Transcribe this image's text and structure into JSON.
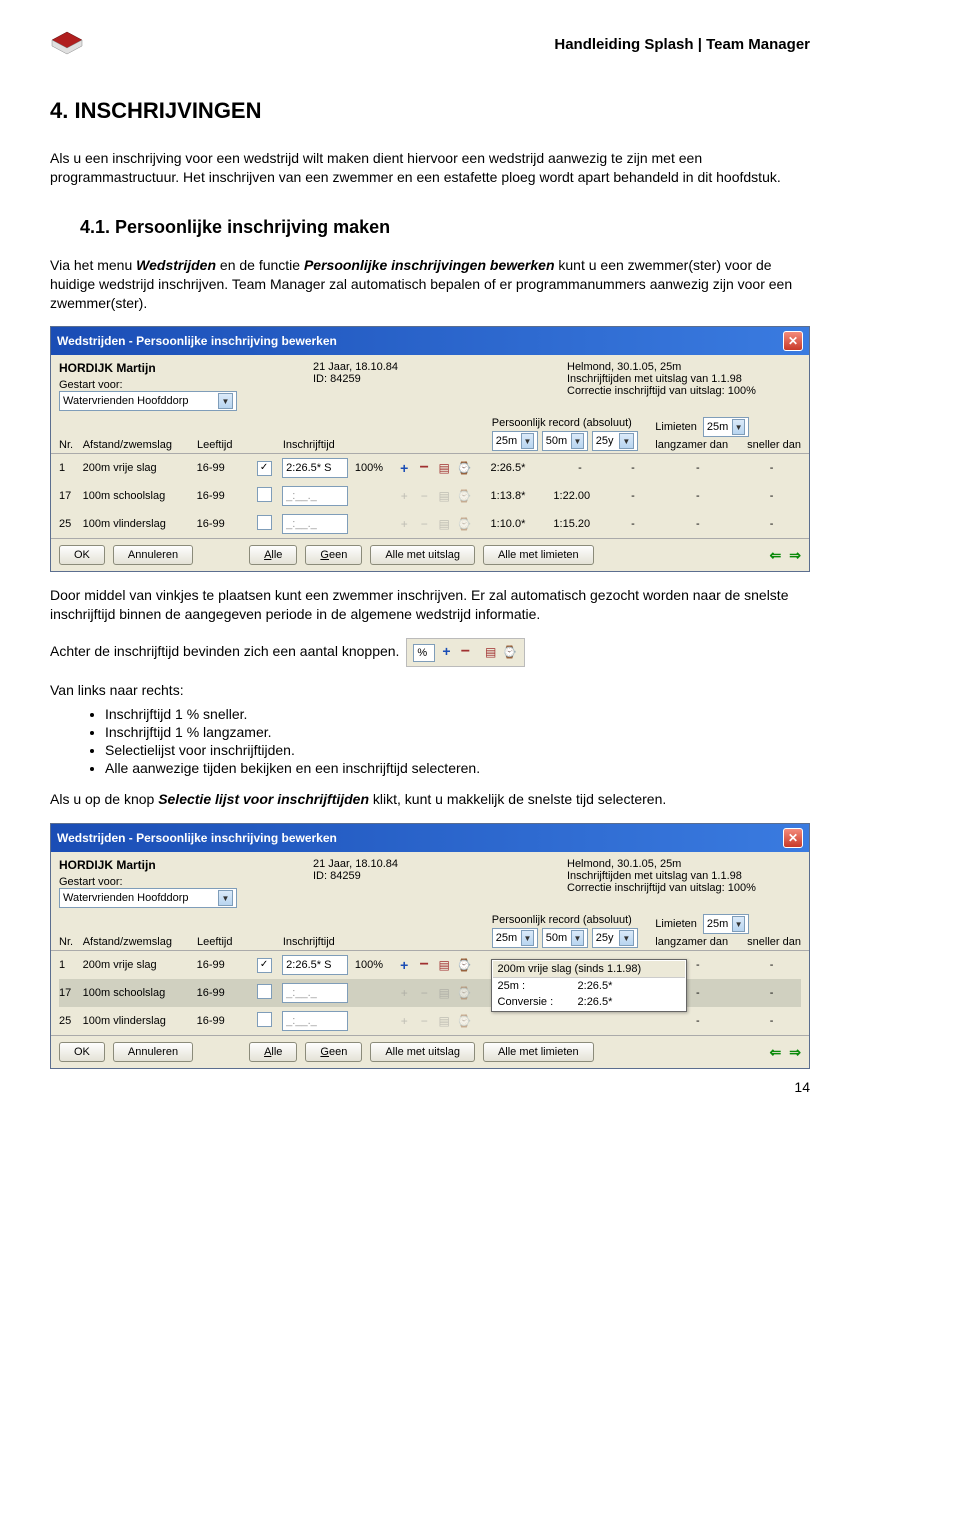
{
  "header": {
    "doc_title": "Handleiding Splash | Team Manager"
  },
  "h1": "4.  INSCHRIJVINGEN",
  "p1": "Als u een inschrijving voor een wedstrijd wilt maken dient hiervoor een wedstrijd aanwezig te zijn met een programmastructuur. Het inschrijven van een zwemmer en een estafette ploeg wordt apart behandeld in dit hoofdstuk.",
  "h2": "4.1.   Persoonlijke inschrijving maken",
  "p2a": "Via het menu ",
  "p2b": "Wedstrijden",
  "p2c": " en de functie ",
  "p2d": "Persoonlijke inschrijvingen bewerken",
  "p2e": " kunt u een zwemmer(ster) voor de huidige wedstrijd inschrijven. Team Manager zal automatisch bepalen of er programmanummers aanwezig zijn voor een zwemmer(ster).",
  "win": {
    "title": "Wedstrijden - Persoonlijke inschrijving bewerken",
    "swimmer": "HORDIJK Martijn",
    "started_label": "Gestart voor:",
    "club": "Watervrienden Hoofddorp",
    "age_line": "21 Jaar, 18.10.84",
    "id_line": "ID: 84259",
    "meet_line": "Helmond, 30.1.05, 25m",
    "entrytimes_line": "Inschrijftijden met uitslag van 1.1.98",
    "correction_line": "Correctie inschrijftijd van uitslag: 100%",
    "hdr_nr": "Nr.",
    "hdr_event": "Afstand/zwemslag",
    "hdr_age": "Leeftijd",
    "hdr_entrytime": "Inschrijftijd",
    "hdr_pr": "Persoonlijk record (absoluut)",
    "hdr_limits": "Limieten",
    "hdr_slower": "langzamer dan",
    "hdr_faster": "sneller dan",
    "pr_25": "25m",
    "pr_50": "50m",
    "pr_25y": "25y",
    "lim_25": "25m",
    "rows": [
      {
        "nr": "1",
        "event": "200m vrije slag",
        "age": "16-99",
        "checked": true,
        "time": "2:26.5* S",
        "pct": "100%",
        "pr25": "2:26.5*",
        "pr50": "-",
        "pr25y": "-",
        "l1": "-",
        "l2": "-"
      },
      {
        "nr": "17",
        "event": "100m schoolslag",
        "age": "16-99",
        "checked": false,
        "time": "_:__._",
        "pct": "",
        "pr25": "1:13.8*",
        "pr50": "1:22.00",
        "pr25y": "-",
        "l1": "-",
        "l2": "-"
      },
      {
        "nr": "25",
        "event": "100m vlinderslag",
        "age": "16-99",
        "checked": false,
        "time": "_:__._",
        "pct": "",
        "pr25": "1:10.0*",
        "pr50": "1:15.20",
        "pr25y": "-",
        "l1": "-",
        "l2": "-"
      }
    ],
    "btn_ok": "OK",
    "btn_cancel": "Annuleren",
    "btn_all": "Alle",
    "btn_none": "Geen",
    "btn_all_result": "Alle met uitslag",
    "btn_all_limit": "Alle met limieten"
  },
  "p3": "Door middel van vinkjes te plaatsen kunt een zwemmer inschrijven. Er zal automatisch gezocht worden naar de snelste inschrijftijd binnen de aangegeven periode in de algemene wedstrijd informatie.",
  "p4": "Achter de inschrijftijd bevinden zich een aantal knoppen.",
  "inline_percent": "%",
  "list_lead": "Van links naar rechts:",
  "li1": "Inschrijftijd 1 % sneller.",
  "li2": "Inschrijftijd 1 % langzamer.",
  "li3": "Selectielijst voor inschrijftijden.",
  "li4": "Alle aanwezige tijden bekijken en een inschrijftijd selecteren.",
  "p5a": "Als u op de knop ",
  "p5b": "Selectie lijst voor inschrijftijden",
  "p5c": " klikt, kunt u makkelijk de snelste tijd selecteren.",
  "popup": {
    "title": "200m vrije slag  (sinds 1.1.98)",
    "r1a": "25m :",
    "r1b": "2:26.5*",
    "r2a": "Conversie :",
    "r2b": "2:26.5*"
  },
  "page_num": "14"
}
